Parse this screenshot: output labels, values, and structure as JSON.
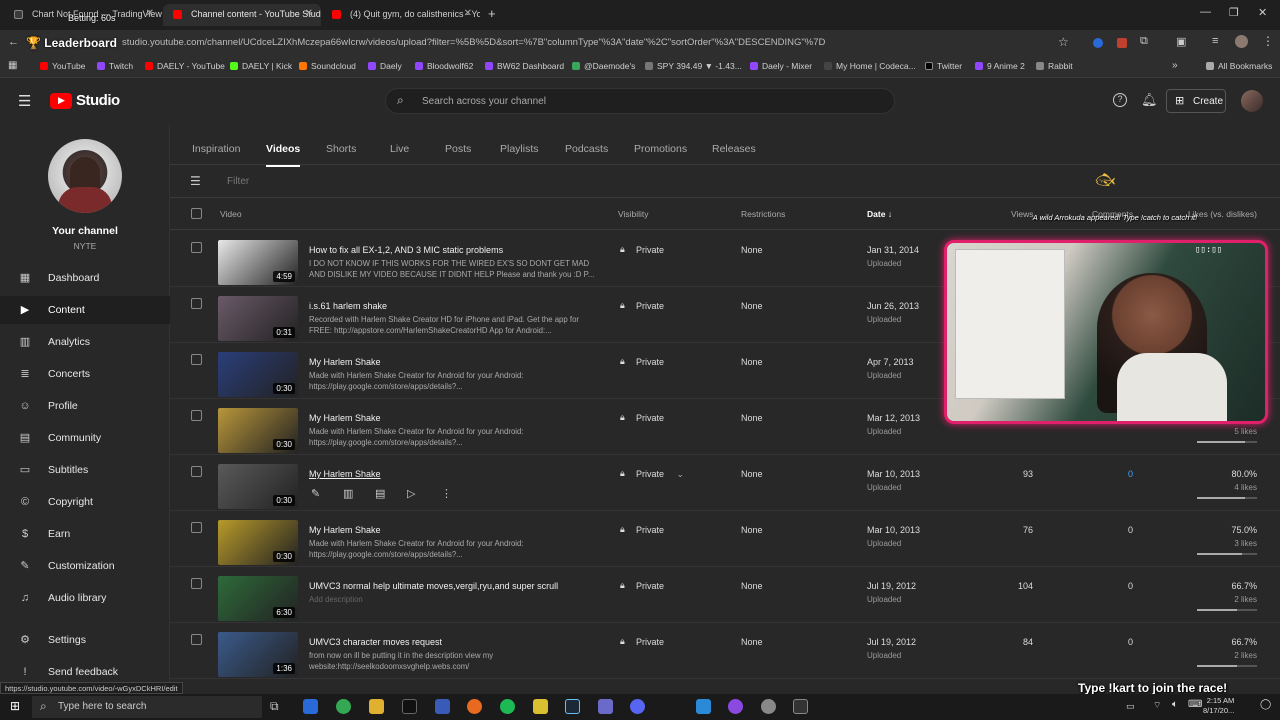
{
  "browser": {
    "tabs": [
      {
        "title": "Chart Not Found — TradingView",
        "color": "#3a3a3a"
      },
      {
        "title": "Channel content - YouTube Studio",
        "color": "#ff0000"
      },
      {
        "title": "(4) Quit gym, do calisthenics - YouTube",
        "color": "#ff0000"
      }
    ],
    "url": "studio.youtube.com/channel/UCdceLZIXhMczepa66wIcrw/videos/upload?filter=%5B%5D&sort=%7B\"columnType\"%3A\"date\"%2C\"sortOrder\"%3A\"DESCENDING\"%7D",
    "bookmarks": [
      {
        "label": "YouTube",
        "color": "#ff0000"
      },
      {
        "label": "Twitch",
        "color": "#9146ff"
      },
      {
        "label": "DAELY - YouTube",
        "color": "#ff0000"
      },
      {
        "label": "DAELY | Kick",
        "color": "#53fc18"
      },
      {
        "label": "Soundcloud",
        "color": "#ff7700"
      },
      {
        "label": "Daely",
        "color": "#9146ff"
      },
      {
        "label": "Bloodwolf62",
        "color": "#9146ff"
      },
      {
        "label": "BW62 Dashboard",
        "color": "#9146ff"
      },
      {
        "label": "@Daemode's",
        "color": "#3ba55c"
      },
      {
        "label": "SPY 394.49 ▼ -1.43...",
        "color": "#777777"
      },
      {
        "label": "Daely - Mixer",
        "color": "#9146ff"
      },
      {
        "label": "My Home | Codeca...",
        "color": "#444444"
      },
      {
        "label": "Twitter",
        "color": "#000000"
      },
      {
        "label": "9 Anime 2",
        "color": "#9146ff"
      },
      {
        "label": "Rabbit",
        "color": "#888888"
      }
    ],
    "all_bookmarks": "All Bookmarks"
  },
  "overlay": {
    "leaderboard": "Leaderboard",
    "betting": "Betting: 60s",
    "arrokuda": "A wild Arrokuda appeared! Type !catch to catch it!",
    "race": "Type !kart to join the race!",
    "status_url": "https://studio.youtube.com/video/-wGyxDCkHRI/edit"
  },
  "header": {
    "logo": "Studio",
    "search_placeholder": "Search across your channel",
    "create": "Create"
  },
  "channel": {
    "label": "Your channel",
    "name": "NYTE"
  },
  "sidebar": {
    "items": [
      {
        "label": "Dashboard",
        "icon": "▦"
      },
      {
        "label": "Content",
        "icon": "▶"
      },
      {
        "label": "Analytics",
        "icon": "▥"
      },
      {
        "label": "Concerts",
        "icon": "≣"
      },
      {
        "label": "Profile",
        "icon": "☺"
      },
      {
        "label": "Community",
        "icon": "▤"
      },
      {
        "label": "Subtitles",
        "icon": "▭"
      },
      {
        "label": "Copyright",
        "icon": "©"
      },
      {
        "label": "Earn",
        "icon": "$"
      },
      {
        "label": "Customization",
        "icon": "✎"
      },
      {
        "label": "Audio library",
        "icon": "♫"
      },
      {
        "label": "Settings",
        "icon": "⚙"
      },
      {
        "label": "Send feedback",
        "icon": "!"
      }
    ],
    "active": "Content"
  },
  "tabs": [
    "Inspiration",
    "Videos",
    "Shorts",
    "Live",
    "Posts",
    "Playlists",
    "Podcasts",
    "Promotions",
    "Releases"
  ],
  "active_tab": "Videos",
  "filter_placeholder": "Filter",
  "columns": {
    "video": "Video",
    "visibility": "Visibility",
    "restrictions": "Restrictions",
    "date": "Date",
    "views": "Views",
    "comments": "Comments",
    "likes": "Likes (vs. dislikes)"
  },
  "rows": [
    {
      "title": "How to fix all EX-1,2, AND 3 MIC static problems",
      "desc": "I DO NOT KNOW IF THIS WORKS FOR THE WIRED EX'S SO DONT GET MAD AND DISLIKE MY VIDEO BECAUSE IT DIDNT HELP Please and thank you :D P...",
      "duration": "4:59",
      "visibility": "Private",
      "restrictions": "None",
      "date": "Jan 31, 2014",
      "status": "Uploaded",
      "views": "",
      "comments": "",
      "likes_pct": "",
      "likes_count": "",
      "likes_frac": 0,
      "thumb": "#e8e8e8"
    },
    {
      "title": "i.s.61 harlem shake",
      "desc": "Recorded with Harlem Shake Creator HD for iPhone and iPad. Get the app for FREE: http://appstore.com/HarlemShakeCreatorHD App for Android:...",
      "duration": "0:31",
      "visibility": "Private",
      "restrictions": "None",
      "date": "Jun 26, 2013",
      "status": "Uploaded",
      "views": "",
      "comments": "",
      "likes_pct": "",
      "likes_count": "",
      "likes_frac": 0,
      "thumb": "#6a5a68"
    },
    {
      "title": "My Harlem Shake",
      "desc": "Made with Harlem Shake Creator for Android for your Android: https://play.google.com/store/apps/details?...",
      "duration": "0:30",
      "visibility": "Private",
      "restrictions": "None",
      "date": "Apr 7, 2013",
      "status": "Uploaded",
      "views": "",
      "comments": "",
      "likes_pct": "",
      "likes_count": "",
      "likes_frac": 0,
      "thumb": "#2a3e7a"
    },
    {
      "title": "My Harlem Shake",
      "desc": "Made with Harlem Shake Creator for Android for your Android: https://play.google.com/store/apps/details?...",
      "duration": "0:30",
      "visibility": "Private",
      "restrictions": "None",
      "date": "Mar 12, 2013",
      "status": "Uploaded",
      "views": "",
      "comments": "",
      "likes_pct": "",
      "likes_count": "5 likes",
      "likes_frac": 0.8,
      "thumb": "#b8963a"
    },
    {
      "title": "My Harlem Shake",
      "desc": "",
      "duration": "0:30",
      "visibility": "Private",
      "restrictions": "None",
      "date": "Mar 10, 2013",
      "status": "Uploaded",
      "views": "93",
      "comments": "0",
      "likes_pct": "80.0%",
      "likes_count": "4 likes",
      "likes_frac": 0.8,
      "thumb": "#5a5a5a"
    },
    {
      "title": "My Harlem Shake",
      "desc": "Made with Harlem Shake Creator for Android for your Android: https://play.google.com/store/apps/details?...",
      "duration": "0:30",
      "visibility": "Private",
      "restrictions": "None",
      "date": "Mar 10, 2013",
      "status": "Uploaded",
      "views": "76",
      "comments": "0",
      "likes_pct": "75.0%",
      "likes_count": "3 likes",
      "likes_frac": 0.75,
      "thumb": "#b89a2a"
    },
    {
      "title": "UMVC3 normal help ultimate moves,vergil,ryu,and super scrull",
      "desc": "Add description",
      "duration": "6:30",
      "visibility": "Private",
      "restrictions": "None",
      "date": "Jul 19, 2012",
      "status": "Uploaded",
      "views": "104",
      "comments": "0",
      "likes_pct": "66.7%",
      "likes_count": "2 likes",
      "likes_frac": 0.667,
      "thumb": "#2e6a3a"
    },
    {
      "title": "UMVC3 character moves request",
      "desc": "from now on ill be putting it in the description view my website:http://seelkodoomxsvghelp.webs.com/",
      "duration": "1:36",
      "visibility": "Private",
      "restrictions": "None",
      "date": "Jul 19, 2012",
      "status": "Uploaded",
      "views": "84",
      "comments": "0",
      "likes_pct": "66.7%",
      "likes_count": "2 likes",
      "likes_frac": 0.667,
      "thumb": "#3a5a8a"
    }
  ],
  "taskbar": {
    "search_placeholder": "Type here to search",
    "time": "2:15 AM",
    "date": "8/17/20..."
  }
}
